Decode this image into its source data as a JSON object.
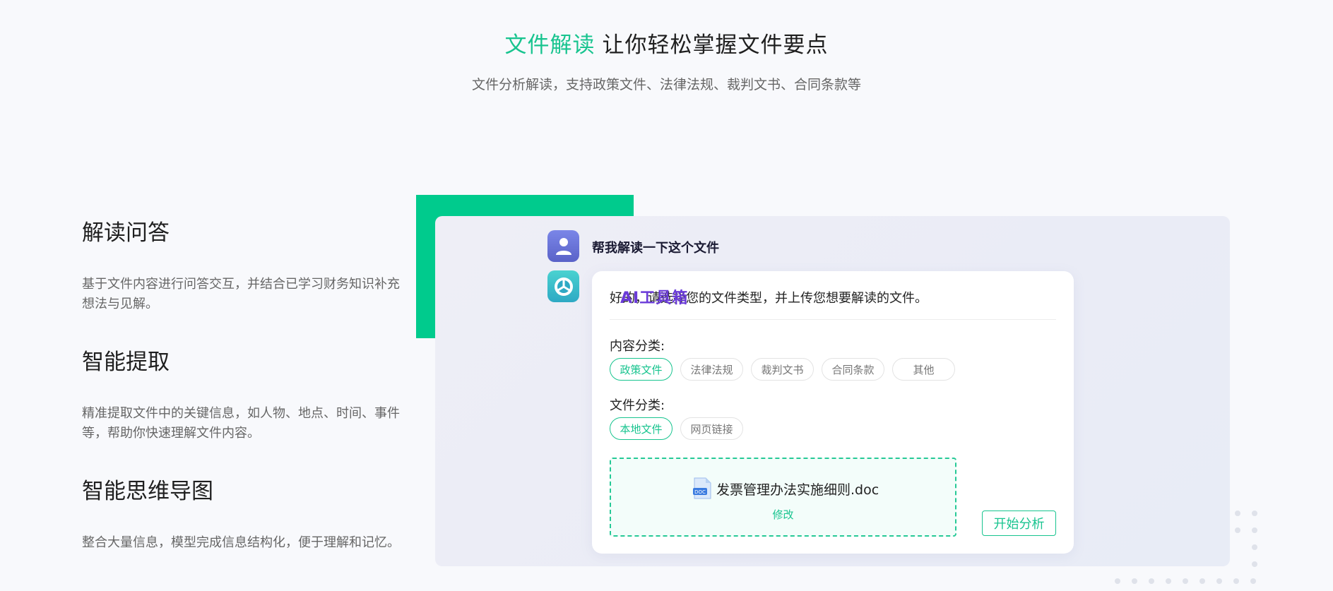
{
  "hero": {
    "title_accent": "文件解读",
    "title_rest": "让你轻松掌握文件要点",
    "subtitle": "文件分析解读，支持政策文件、法律法规、裁判文书、合同条款等"
  },
  "features": [
    {
      "title": "解读问答",
      "desc": "基于文件内容进行问答交互，并结合已学习财务知识补充想法与见解。"
    },
    {
      "title": "智能提取",
      "desc": "精准提取文件中的关键信息，如人物、地点、时间、事件等，帮助你快速理解文件内容。"
    },
    {
      "title": "智能思维导图",
      "desc": "整合大量信息，模型完成信息结构化，便于理解和记忆。"
    }
  ],
  "chat": {
    "user_message": "帮我解读一下这个文件",
    "bot_greeting": "好的，请选择您的文件类型，并上传您想要解读的文件。",
    "watermark": "AI工具箱",
    "content_label": "内容分类:",
    "content_options": [
      "政策文件",
      "法律法规",
      "裁判文书",
      "合同条款",
      "其他"
    ],
    "file_label": "文件分类:",
    "file_options": [
      "本地文件",
      "网页链接"
    ],
    "file_name": "发票管理办法实施细则.doc",
    "file_badge": "DOC",
    "modify_label": "修改",
    "start_button": "开始分析"
  },
  "colors": {
    "accent": "#18c48f",
    "green_block": "#00cb8d"
  }
}
